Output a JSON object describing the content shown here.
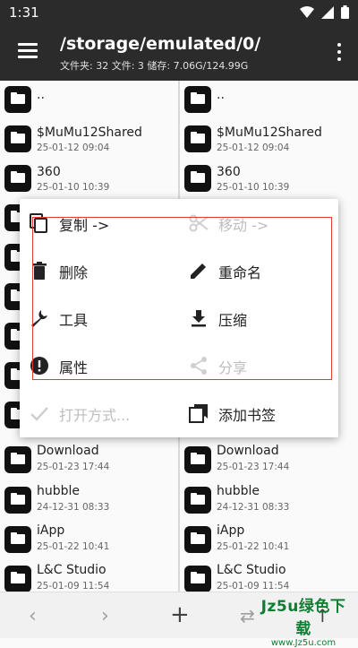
{
  "status_bar": {
    "time": "1:31"
  },
  "app_bar": {
    "path": "/storage/emulated/0/",
    "stats": "文件夹: 32  文件: 3  储存: 7.06G/124.99G"
  },
  "left_pane": {
    "items": [
      {
        "name": "..",
        "date": ""
      },
      {
        "name": "$MuMu12Shared",
        "date": "25-01-12 09:04"
      },
      {
        "name": "360",
        "date": "25-01-10 10:39"
      },
      {
        "name": "",
        "date": ""
      },
      {
        "name": "",
        "date": ""
      },
      {
        "name": "",
        "date": ""
      },
      {
        "name": "",
        "date": ""
      },
      {
        "name": "",
        "date": ""
      },
      {
        "name": "",
        "date": ""
      },
      {
        "name": "Download",
        "date": "25-01-23 17:44"
      },
      {
        "name": "hubble",
        "date": "24-12-31 08:33"
      },
      {
        "name": "iApp",
        "date": "25-01-22 10:41"
      },
      {
        "name": "L&C Studio",
        "date": "25-01-09 11:54"
      }
    ]
  },
  "right_pane": {
    "items": [
      {
        "name": "..",
        "date": ""
      },
      {
        "name": "$MuMu12Shared",
        "date": "25-01-12 09:04"
      },
      {
        "name": "360",
        "date": "25-01-10 10:39"
      },
      {
        "name": "",
        "date": ""
      },
      {
        "name": "",
        "date": ""
      },
      {
        "name": "",
        "date": ""
      },
      {
        "name": "",
        "date": ""
      },
      {
        "name": "",
        "date": ""
      },
      {
        "name": "",
        "date": ""
      },
      {
        "name": "Download",
        "date": "25-01-23 17:44"
      },
      {
        "name": "hubble",
        "date": "24-12-31 08:33"
      },
      {
        "name": "iApp",
        "date": "25-01-22 10:41"
      },
      {
        "name": "L&C Studio",
        "date": "25-01-09 11:54"
      }
    ]
  },
  "context_menu": {
    "items": [
      {
        "label": "复制 ->",
        "icon": "copy-icon",
        "enabled": true
      },
      {
        "label": "移动 ->",
        "icon": "cut-icon",
        "enabled": false
      },
      {
        "label": "删除",
        "icon": "trash-icon",
        "enabled": true
      },
      {
        "label": "重命名",
        "icon": "pencil-icon",
        "enabled": true
      },
      {
        "label": "工具",
        "icon": "wrench-icon",
        "enabled": true
      },
      {
        "label": "压缩",
        "icon": "download-icon",
        "enabled": true
      },
      {
        "label": "属性",
        "icon": "info-icon",
        "enabled": true
      },
      {
        "label": "分享",
        "icon": "share-icon",
        "enabled": false
      },
      {
        "label": "打开方式...",
        "icon": "check-icon",
        "enabled": false
      },
      {
        "label": "添加书签",
        "icon": "bookmark-icon",
        "enabled": true
      }
    ]
  },
  "bottom_bar": {
    "icons": [
      "back-icon",
      "forward-icon",
      "add-icon",
      "swap-icon",
      "up-icon"
    ]
  },
  "watermark": {
    "main": "Jz5u绿色下载",
    "sub": "www.Jz5u.com"
  },
  "colors": {
    "appbar": "#2b2b2b",
    "highlight_border": "#e53935",
    "watermark": "#0f7d32"
  }
}
